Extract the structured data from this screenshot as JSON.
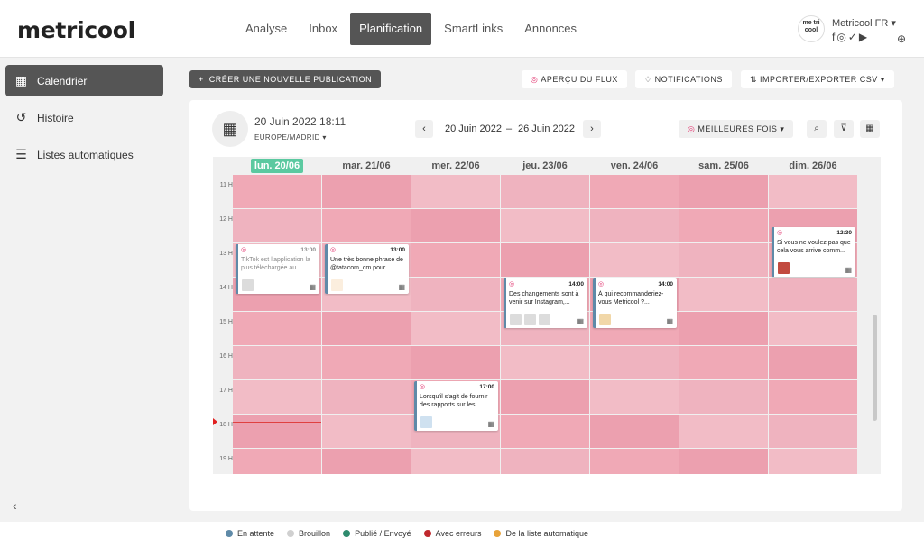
{
  "app": {
    "logo": "metricool"
  },
  "nav": [
    "Analyse",
    "Inbox",
    "Planification",
    "SmartLinks",
    "Annonces"
  ],
  "account": {
    "logo_text": "me tri cool",
    "name": "Metricool FR"
  },
  "sidebar": {
    "items": [
      {
        "label": "Calendrier",
        "icon": "calendar-icon"
      },
      {
        "label": "Histoire",
        "icon": "history-icon"
      },
      {
        "label": "Listes automatiques",
        "icon": "list-icon"
      }
    ]
  },
  "toolbar": {
    "create": "CRÉER UNE NOUVELLE PUBLICATION",
    "feed": "APERÇU DU FLUX",
    "notifications": "NOTIFICATIONS",
    "import": "IMPORTER/EXPORTER CSV"
  },
  "calendar": {
    "date": "20 Juin 2022 18:11",
    "timezone": "EUROPE/MADRID",
    "range_start": "20 Juin 2022",
    "range_sep": "–",
    "range_end": "26 Juin 2022",
    "best": "MEILLEURES FOIS",
    "days": [
      "lun. 20/06",
      "mar. 21/06",
      "mer. 22/06",
      "jeu. 23/06",
      "ven. 24/06",
      "sam. 25/06",
      "dim. 26/06"
    ],
    "hours": [
      "11 H",
      "12 H",
      "13 H",
      "14 H",
      "15 H",
      "16 H",
      "17 H",
      "18 H",
      "19 H"
    ]
  },
  "posts": [
    {
      "time": "13:00",
      "text": "TikTok est l'application la plus téléchargée au..."
    },
    {
      "time": "13:00",
      "text": "Une très bonne phrase de @tatacom_cm pour..."
    },
    {
      "time": "17:00",
      "text": "Lorsqu'il s'agit de fournir des rapports sur les..."
    },
    {
      "time": "14:00",
      "text": "Des changements sont à venir sur Instagram,..."
    },
    {
      "time": "14:00",
      "text": "À qui recommanderiez-vous Metricool ?..."
    },
    {
      "time": "12:30",
      "text": "Si vous ne voulez pas que cela vous arrive comm..."
    }
  ],
  "legend": [
    {
      "label": "En attente",
      "color": "#5f8aa8"
    },
    {
      "label": "Brouillon",
      "color": "#d0d0d0"
    },
    {
      "label": "Publié / Envoyé",
      "color": "#2e8b6e"
    },
    {
      "label": "Avec erreurs",
      "color": "#c0282d"
    },
    {
      "label": "De la liste automatique",
      "color": "#e8a33a"
    }
  ]
}
